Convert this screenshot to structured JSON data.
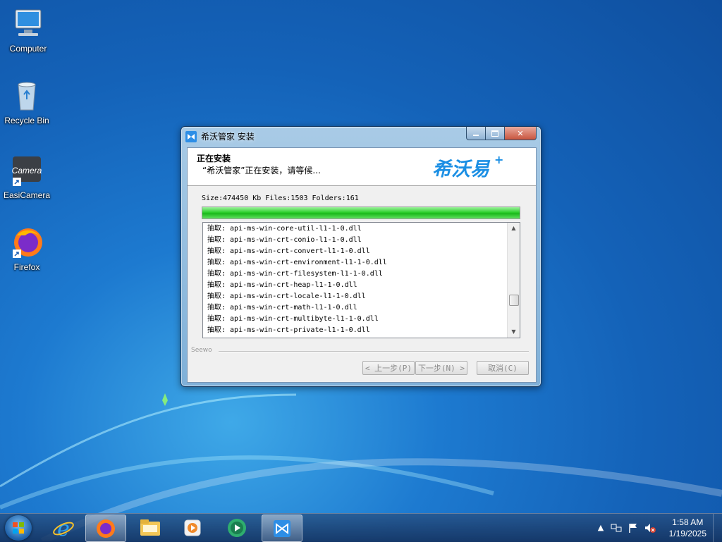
{
  "desktop": {
    "icons": [
      {
        "label": "Computer"
      },
      {
        "label": "Recycle Bin"
      },
      {
        "label": "EasiCamera",
        "badge": "Camera"
      },
      {
        "label": "Firefox"
      }
    ]
  },
  "window": {
    "title": "希沃管家 安装",
    "header_title": "正在安装",
    "header_subtitle": "“希沃管家”正在安装，请等候...",
    "logo_text": "希沃易",
    "size_line": "Size:474450 Kb  Files:1503  Folders:161",
    "progress_fraction": 1.0,
    "log_lines": [
      "抽取: api-ms-win-core-util-l1-1-0.dll",
      "抽取: api-ms-win-crt-conio-l1-1-0.dll",
      "抽取: api-ms-win-crt-convert-l1-1-0.dll",
      "抽取: api-ms-win-crt-environment-l1-1-0.dll",
      "抽取: api-ms-win-crt-filesystem-l1-1-0.dll",
      "抽取: api-ms-win-crt-heap-l1-1-0.dll",
      "抽取: api-ms-win-crt-locale-l1-1-0.dll",
      "抽取: api-ms-win-crt-math-l1-1-0.dll",
      "抽取: api-ms-win-crt-multibyte-l1-1-0.dll",
      "抽取: api-ms-win-crt-private-l1-1-0.dll"
    ],
    "brand": "Seewo",
    "buttons": {
      "back": "< 上一步(P)",
      "next": "下一步(N) >",
      "cancel": "取消(C)"
    }
  },
  "taskbar": {
    "items": [
      "internet-explorer-icon",
      "firefox-icon",
      "file-explorer-icon",
      "media-player-icon",
      "media-center-icon",
      "seewo-installer-icon"
    ],
    "clock_time": "1:58 AM",
    "clock_date": "1/19/2025"
  },
  "colors": {
    "desktop_blue": "#1d7ad0",
    "progress_green": "#2fd12f",
    "accent": "#2d8ee6"
  }
}
